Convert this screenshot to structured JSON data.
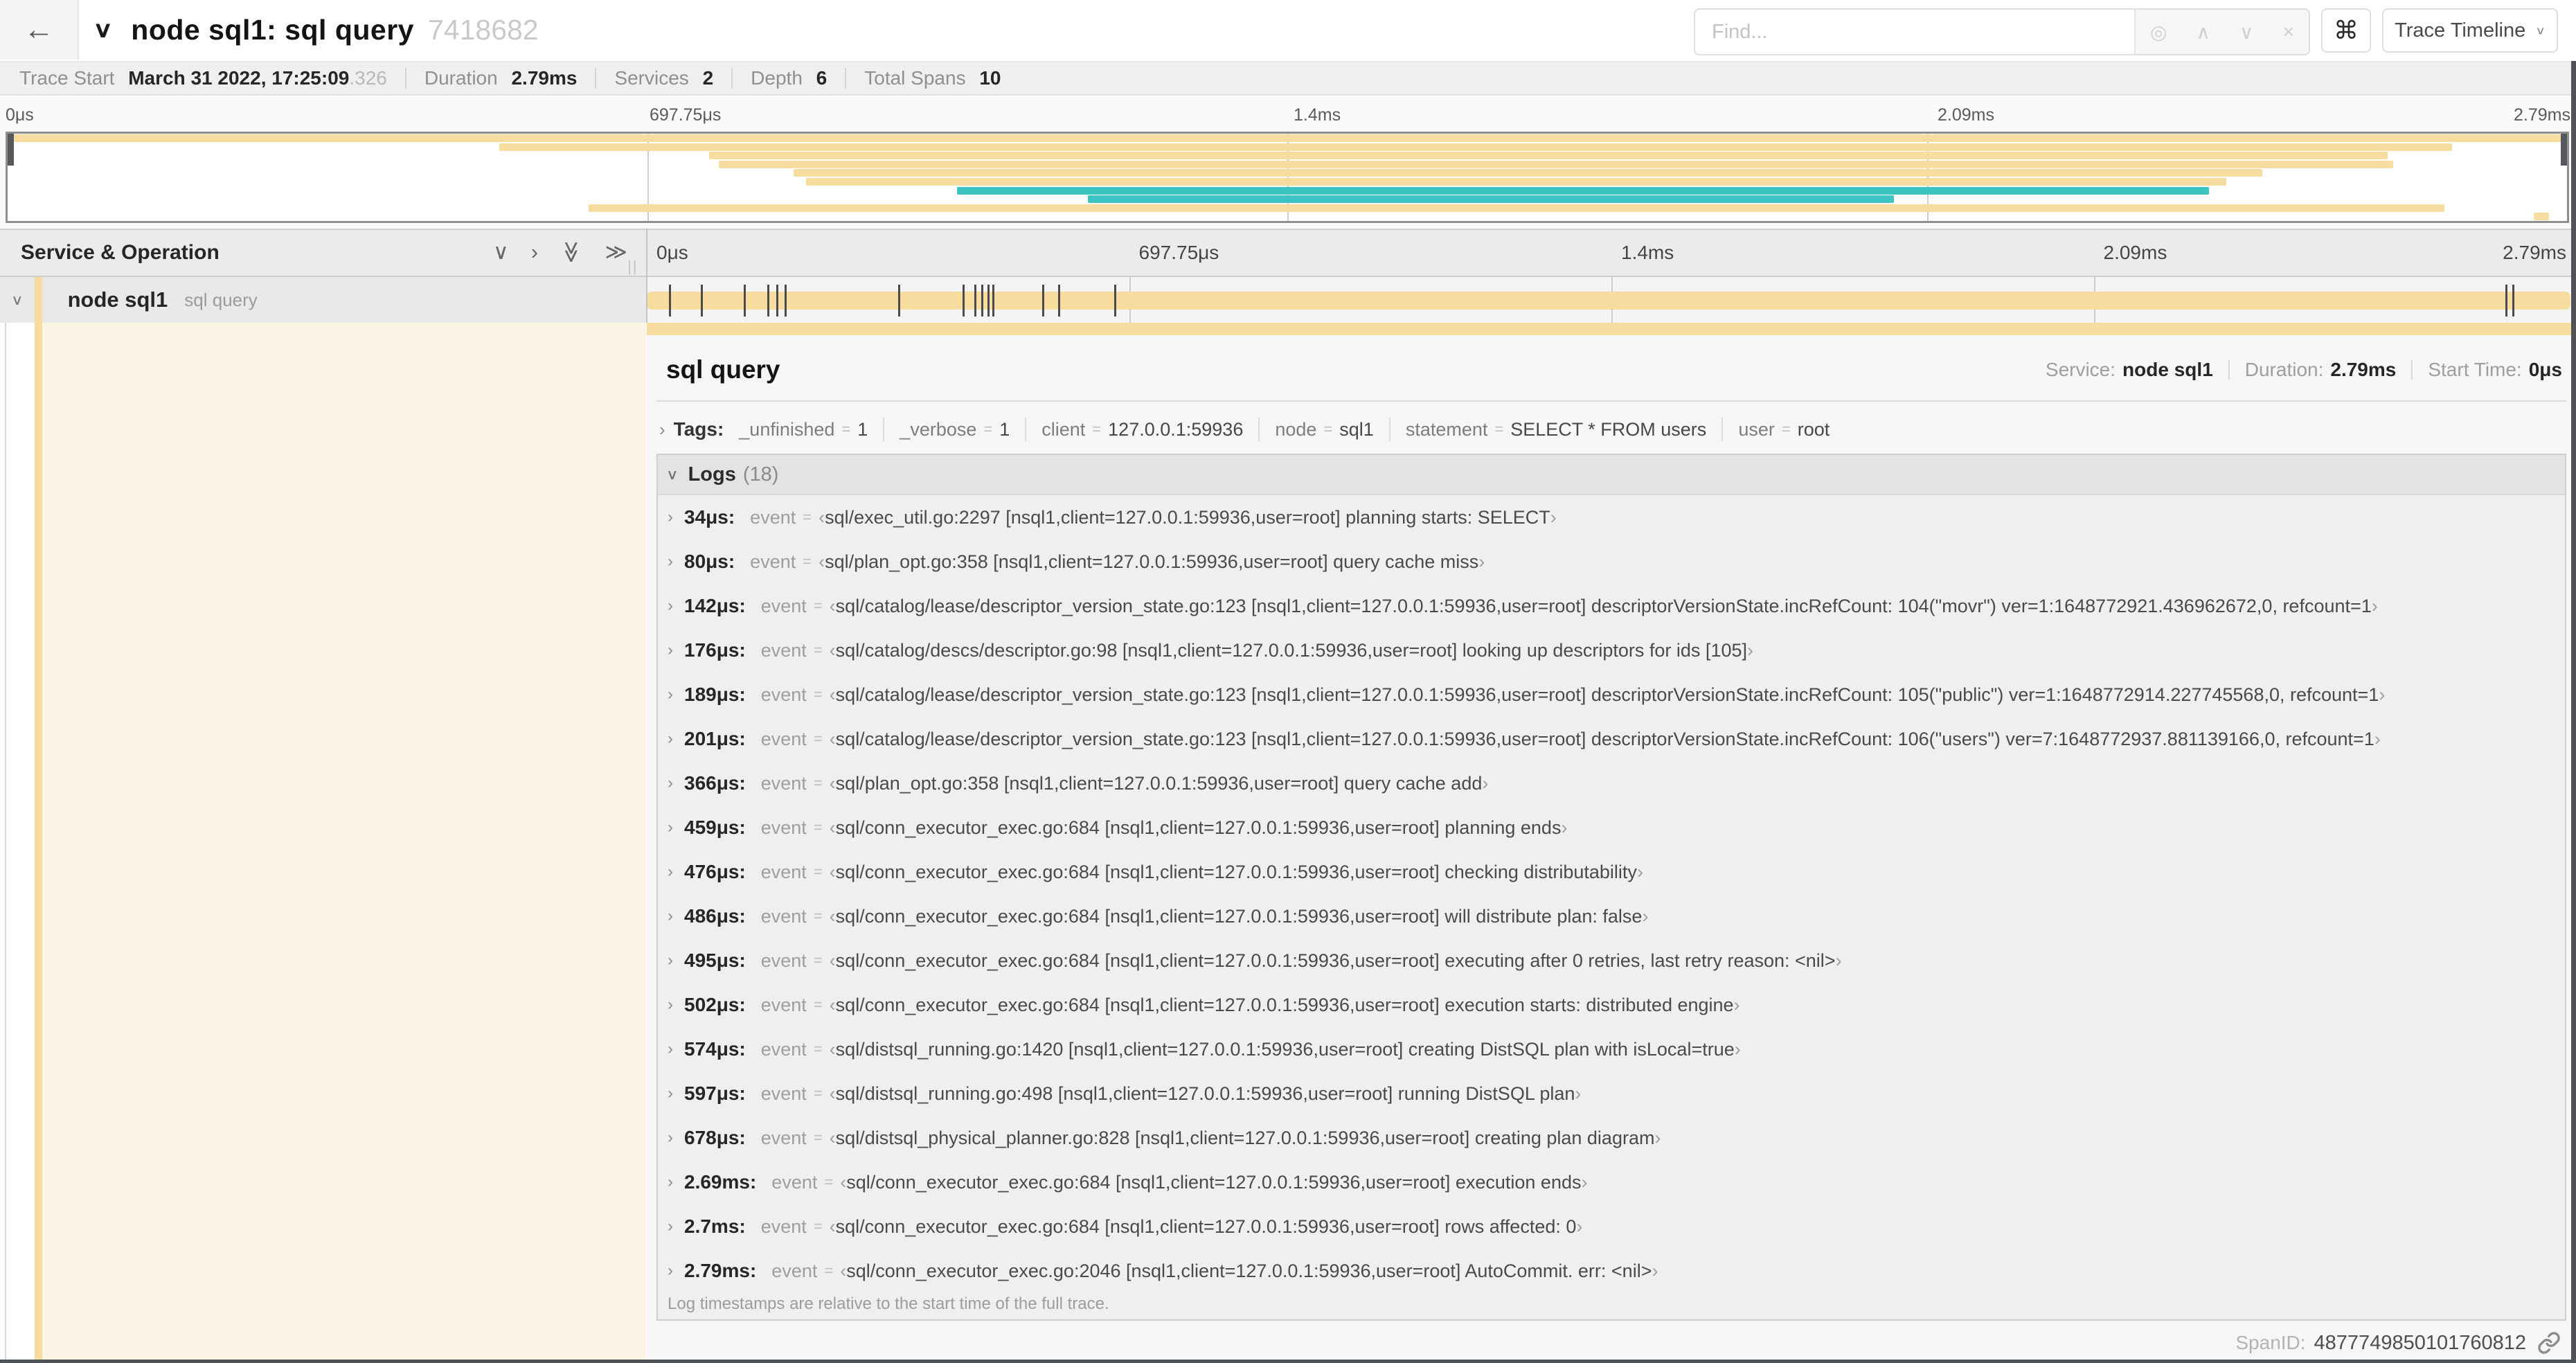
{
  "colors": {
    "tan": "#F7DCA0",
    "teal": "#3EC3C3",
    "cream": "#FCF5E5"
  },
  "duration_us": 2790,
  "header": {
    "back_icon": "←",
    "title": "node sql1: sql query",
    "trace_id": "7418682",
    "find_placeholder": "Find...",
    "keyboard_shortcut_icon": "⌘",
    "view_selector": "Trace Timeline"
  },
  "stats": [
    {
      "label": "Trace Start",
      "value": "March 31 2022, 17:25:09",
      "suffix": ".326"
    },
    {
      "label": "Duration",
      "value": "2.79ms"
    },
    {
      "label": "Services",
      "value": "2"
    },
    {
      "label": "Depth",
      "value": "6"
    },
    {
      "label": "Total Spans",
      "value": "10"
    }
  ],
  "timeline_ticks": [
    {
      "label": "0μs",
      "pct": 0
    },
    {
      "label": "697.75μs",
      "pct": 25
    },
    {
      "label": "1.4ms",
      "pct": 50
    },
    {
      "label": "2.09ms",
      "pct": 75
    },
    {
      "label": "2.79ms",
      "pct": 100
    }
  ],
  "minimap_spans": [
    {
      "start": 0,
      "end": 100,
      "color": "tan"
    },
    {
      "start": 19.2,
      "end": 95.5,
      "color": "tan"
    },
    {
      "start": 27.4,
      "end": 93.0,
      "color": "tan"
    },
    {
      "start": 27.8,
      "end": 93.2,
      "color": "tan"
    },
    {
      "start": 30.7,
      "end": 88.1,
      "color": "tan"
    },
    {
      "start": 31.2,
      "end": 86.7,
      "color": "tan"
    },
    {
      "start": 37.1,
      "end": 86.0,
      "color": "teal"
    },
    {
      "start": 42.2,
      "end": 73.7,
      "color": "teal"
    },
    {
      "start": 22.7,
      "end": 95.2,
      "color": "tan"
    },
    {
      "start": 98.7,
      "end": 99.3,
      "color": "tan"
    }
  ],
  "grid": {
    "left_header": "Service & Operation",
    "collapse_one_icon": "∨",
    "expand_one_icon": "›",
    "collapse_all_icon": "≫",
    "expand_all_icon": "≫",
    "grip": "||"
  },
  "span_row": {
    "expander_icon": "∨",
    "service": "node sql1",
    "operation": "sql query"
  },
  "detail": {
    "title": "sql query",
    "service_label": "Service:",
    "service": "node sql1",
    "duration_label": "Duration:",
    "duration": "2.79ms",
    "start_label": "Start Time:",
    "start": "0μs",
    "tags_label": "Tags:",
    "tags": [
      {
        "key": "_unfinished",
        "value": "1"
      },
      {
        "key": "_verbose",
        "value": "1"
      },
      {
        "key": "client",
        "value": "127.0.0.1:59936"
      },
      {
        "key": "node",
        "value": "sql1"
      },
      {
        "key": "statement",
        "value": "SELECT * FROM users"
      },
      {
        "key": "user",
        "value": "root"
      }
    ],
    "logs_title": "Logs",
    "logs_count": "(18)",
    "logs": [
      {
        "time": "34μs:",
        "t_us": 34,
        "field": "event",
        "value": "sql/exec_util.go:2297 [nsql1,client=127.0.0.1:59936,user=root] planning starts: SELECT"
      },
      {
        "time": "80μs:",
        "t_us": 80,
        "field": "event",
        "value": "sql/plan_opt.go:358 [nsql1,client=127.0.0.1:59936,user=root] query cache miss"
      },
      {
        "time": "142μs:",
        "t_us": 142,
        "field": "event",
        "value": "sql/catalog/lease/descriptor_version_state.go:123 [nsql1,client=127.0.0.1:59936,user=root] descriptorVersionState.incRefCount: 104(\"movr\") ver=1:1648772921.436962672,0, refcount=1"
      },
      {
        "time": "176μs:",
        "t_us": 176,
        "field": "event",
        "value": "sql/catalog/descs/descriptor.go:98 [nsql1,client=127.0.0.1:59936,user=root] looking up descriptors for ids [105]"
      },
      {
        "time": "189μs:",
        "t_us": 189,
        "field": "event",
        "value": "sql/catalog/lease/descriptor_version_state.go:123 [nsql1,client=127.0.0.1:59936,user=root] descriptorVersionState.incRefCount: 105(\"public\") ver=1:1648772914.227745568,0, refcount=1"
      },
      {
        "time": "201μs:",
        "t_us": 201,
        "field": "event",
        "value": "sql/catalog/lease/descriptor_version_state.go:123 [nsql1,client=127.0.0.1:59936,user=root] descriptorVersionState.incRefCount: 106(\"users\") ver=7:1648772937.881139166,0, refcount=1"
      },
      {
        "time": "366μs:",
        "t_us": 366,
        "field": "event",
        "value": "sql/plan_opt.go:358 [nsql1,client=127.0.0.1:59936,user=root] query cache add"
      },
      {
        "time": "459μs:",
        "t_us": 459,
        "field": "event",
        "value": "sql/conn_executor_exec.go:684 [nsql1,client=127.0.0.1:59936,user=root] planning ends"
      },
      {
        "time": "476μs:",
        "t_us": 476,
        "field": "event",
        "value": "sql/conn_executor_exec.go:684 [nsql1,client=127.0.0.1:59936,user=root] checking distributability"
      },
      {
        "time": "486μs:",
        "t_us": 486,
        "field": "event",
        "value": "sql/conn_executor_exec.go:684 [nsql1,client=127.0.0.1:59936,user=root] will distribute plan: false"
      },
      {
        "time": "495μs:",
        "t_us": 495,
        "field": "event",
        "value": "sql/conn_executor_exec.go:684 [nsql1,client=127.0.0.1:59936,user=root] executing after 0 retries, last retry reason: <nil>"
      },
      {
        "time": "502μs:",
        "t_us": 502,
        "field": "event",
        "value": "sql/conn_executor_exec.go:684 [nsql1,client=127.0.0.1:59936,user=root] execution starts: distributed engine"
      },
      {
        "time": "574μs:",
        "t_us": 574,
        "field": "event",
        "value": "sql/distsql_running.go:1420 [nsql1,client=127.0.0.1:59936,user=root] creating DistSQL plan with isLocal=true"
      },
      {
        "time": "597μs:",
        "t_us": 597,
        "field": "event",
        "value": "sql/distsql_running.go:498 [nsql1,client=127.0.0.1:59936,user=root] running DistSQL plan"
      },
      {
        "time": "678μs:",
        "t_us": 678,
        "field": "event",
        "value": "sql/distsql_physical_planner.go:828 [nsql1,client=127.0.0.1:59936,user=root] creating plan diagram"
      },
      {
        "time": "2.69ms:",
        "t_us": 2690,
        "field": "event",
        "value": "sql/conn_executor_exec.go:684 [nsql1,client=127.0.0.1:59936,user=root] execution ends"
      },
      {
        "time": "2.7ms:",
        "t_us": 2700,
        "field": "event",
        "value": "sql/conn_executor_exec.go:684 [nsql1,client=127.0.0.1:59936,user=root] rows affected: 0"
      },
      {
        "time": "2.79ms:",
        "t_us": 2790,
        "field": "event",
        "value": "sql/conn_executor_exec.go:2046 [nsql1,client=127.0.0.1:59936,user=root] AutoCommit. err: <nil>"
      }
    ],
    "footnote": "Log timestamps are relative to the start time of the full trace.",
    "span_id_label": "SpanID:",
    "span_id": "4877749850101760812"
  }
}
